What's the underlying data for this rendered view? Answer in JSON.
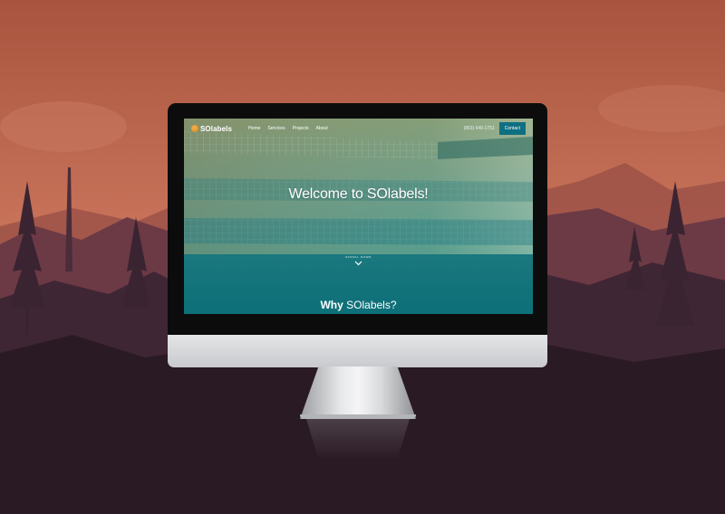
{
  "site": {
    "logo_text": "SOlabels",
    "nav": [
      {
        "label": "Home"
      },
      {
        "label": "Services"
      },
      {
        "label": "Projects"
      },
      {
        "label": "About"
      }
    ],
    "phone": "(863) 640-1751",
    "contact_label": "Contact",
    "hero_title": "Welcome to SOlabels!",
    "scroll_label": "SCROLL DOWN",
    "why_bold": "Why",
    "why_rest": " SOlabels?"
  },
  "icons": {
    "logo": "sun-logo-icon",
    "scroll": "chevron-down-icon"
  },
  "colors": {
    "sky": "#b5634a",
    "screen_teal": "#0d6f78",
    "contact_button": "#0f6f82",
    "logo_orange": "#f0a23a"
  }
}
